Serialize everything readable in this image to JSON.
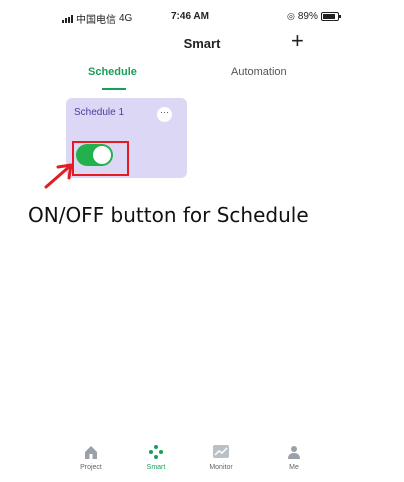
{
  "status_bar": {
    "carrier": "中国电信",
    "network": "4G",
    "time": "7:46 AM",
    "battery": "89%",
    "battery_level": 0.89
  },
  "header": {
    "title": "Smart",
    "add_label": "+"
  },
  "tabs": [
    {
      "label": "Schedule",
      "active": true
    },
    {
      "label": "Automation",
      "active": false
    }
  ],
  "schedule_card": {
    "title": "Schedule 1",
    "more_label": "···",
    "toggle_on": true,
    "color": "#dcd7f4"
  },
  "annotation": {
    "text": "ON/OFF button for Schedule",
    "color": "#e31b23"
  },
  "bottom_nav": [
    {
      "label": "Project",
      "icon": "home-icon",
      "active": false
    },
    {
      "label": "Smart",
      "icon": "smart-dots-icon",
      "active": true
    },
    {
      "label": "Monitor",
      "icon": "monitor-chart-icon",
      "active": false
    },
    {
      "label": "Me",
      "icon": "person-icon",
      "active": false
    }
  ],
  "colors": {
    "accent": "#1a9e5a",
    "toggle": "#22b14c"
  }
}
